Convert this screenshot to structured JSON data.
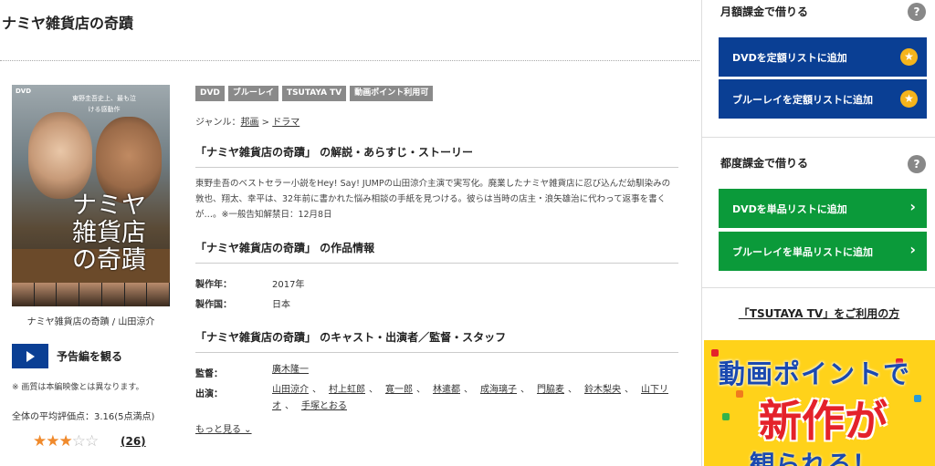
{
  "page": {
    "title": "ナミヤ雑貨店の奇蹟"
  },
  "cover": {
    "dvd_tag": "DVD",
    "tagline": "東野圭吾史上、最も泣ける感動作",
    "title_art": "ナミヤ雑貨店の奇蹟",
    "caption": "ナミヤ雑貨店の奇蹟 / 山田涼介"
  },
  "trailer": {
    "label": "予告編を観る"
  },
  "note": "※ 画質は本編映像とは異なります。",
  "rating": {
    "average_text": "全体の平均評価点：3.16(5点満点)",
    "value": 3,
    "max": 5,
    "count": "(26)"
  },
  "badges": [
    "DVD",
    "ブルーレイ",
    "TSUTAYA TV",
    "動画ポイント利用可"
  ],
  "genre": {
    "label": "ジャンル：",
    "items": [
      "邦画",
      "ドラマ"
    ],
    "sep": " > "
  },
  "synopsis": {
    "heading": "「ナミヤ雑貨店の奇蹟」 の解説・あらすじ・ストーリー",
    "text": "東野圭吾のベストセラー小説をHey! Say! JUMPの山田涼介主演で実写化。廃業したナミヤ雑貨店に忍び込んだ幼馴染みの敦也、翔太、幸平は、32年前に書かれた悩み相談の手紙を見つける。彼らは当時の店主・浪矢雄治に代わって返事を書くが…。※一般告知解禁日：12月8日"
  },
  "work_info": {
    "heading": "「ナミヤ雑貨店の奇蹟」 の作品情報",
    "rows": [
      {
        "key": "製作年：",
        "value": "2017年"
      },
      {
        "key": "製作国：",
        "value": "日本"
      }
    ]
  },
  "cast": {
    "heading": "「ナミヤ雑貨店の奇蹟」 のキャスト・出演者／監督・スタッフ",
    "director_label": "監督：",
    "director": "廣木隆一",
    "actors_label": "出演：",
    "actors": [
      "山田涼介",
      "村上虹郎",
      "寛一郎",
      "林遣都",
      "成海璃子",
      "門脇麦",
      "鈴木梨央",
      "山下リオ",
      "手塚とおる"
    ],
    "separator": "、",
    "more": "もっと見る ⌄"
  },
  "sidebar": {
    "monthly": {
      "heading": "月額課金で借りる",
      "buttons": [
        "DVDを定額リストに追加",
        "ブルーレイを定額リストに追加"
      ]
    },
    "single": {
      "heading": "都度課金で借りる",
      "buttons": [
        "DVDを単品リストに追加",
        "ブルーレイを単品リストに追加"
      ]
    },
    "tsutaya_link": "「TSUTAYA TV」をご利用の方",
    "help_glyph": "?",
    "star_glyph": "★",
    "chevron_glyph": "›",
    "banner": {
      "line1": "動画ポイントで",
      "line2": "新作が",
      "line3": "観られる！"
    }
  }
}
